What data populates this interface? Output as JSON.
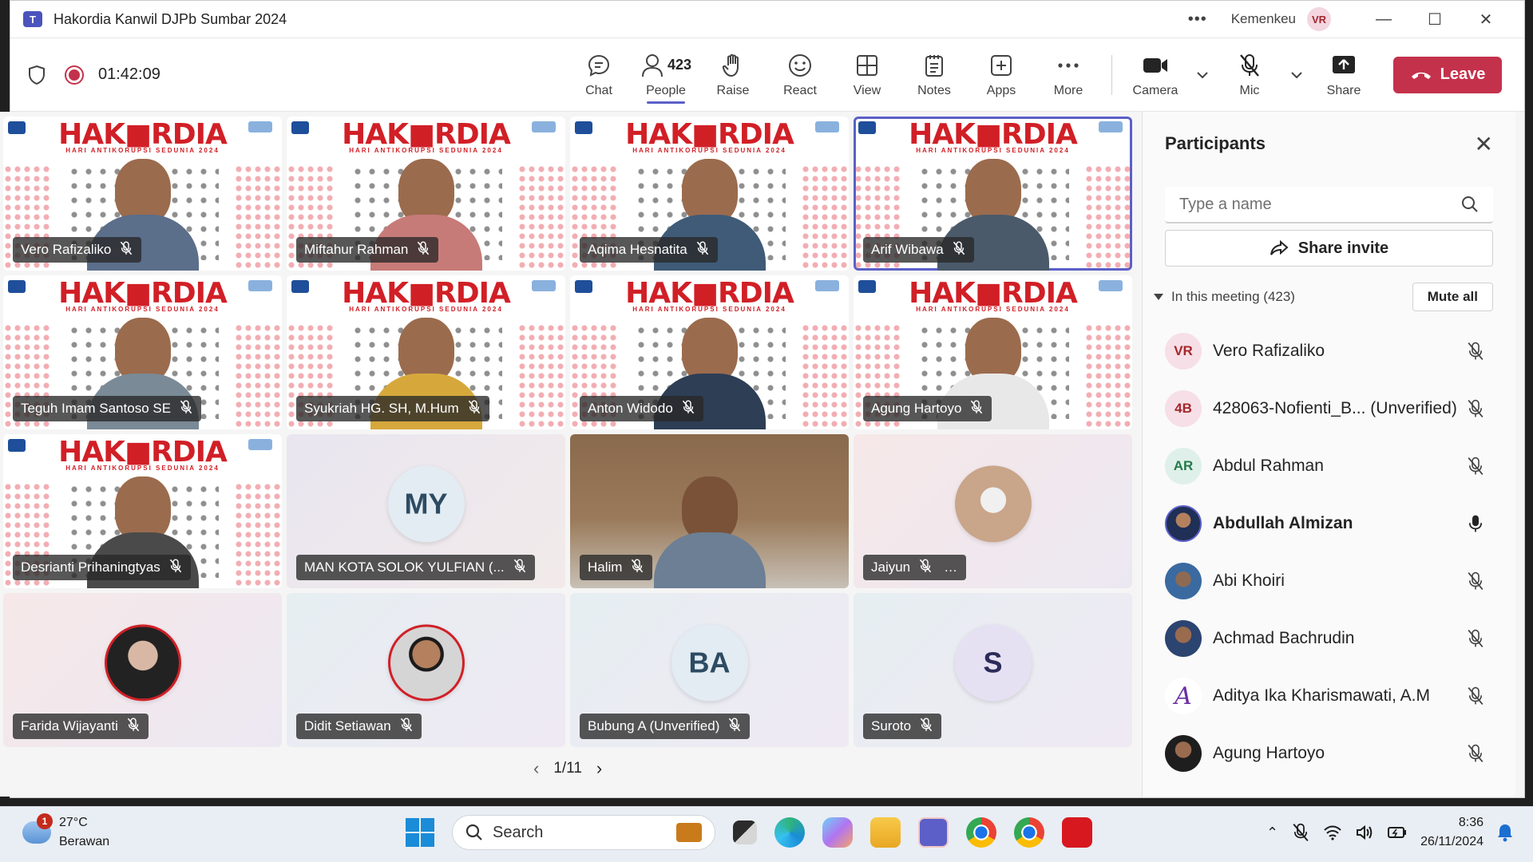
{
  "window": {
    "title": "Hakordia Kanwil DJPb Sumbar 2024",
    "org": "Kemenkeu",
    "user_initials": "VR",
    "logo_letter": "T"
  },
  "toolbar": {
    "timer": "01:42:09",
    "people_count": "423",
    "buttons": {
      "chat": "Chat",
      "people": "People",
      "raise": "Raise",
      "react": "React",
      "view": "View",
      "notes": "Notes",
      "apps": "Apps",
      "more": "More",
      "camera": "Camera",
      "mic": "Mic",
      "share": "Share"
    },
    "leave": "Leave"
  },
  "banner": {
    "title": "HAK■RDIA",
    "subtitle": "HARI ANTIKORUPSI SEDUNIA 2024"
  },
  "tiles": [
    {
      "name": "Vero Rafizaliko"
    },
    {
      "name": "Miftahur Rahman"
    },
    {
      "name": "Aqima Hesnatita"
    },
    {
      "name": "Arif Wibawa"
    },
    {
      "name": "Teguh Imam Santoso SE"
    },
    {
      "name": "Syukriah HG. SH, M.Hum"
    },
    {
      "name": "Anton Widodo"
    },
    {
      "name": "Agung Hartoyo"
    },
    {
      "name": "Desrianti Prihaningtyas"
    },
    {
      "name": "MAN KOTA SOLOK YULFIAN (...",
      "initials": "MY"
    },
    {
      "name": "Halim"
    },
    {
      "name": "Jaiyun",
      "more": "…"
    },
    {
      "name": "Farida Wijayanti"
    },
    {
      "name": "Didit Setiawan"
    },
    {
      "name": "Bubung A (Unverified)",
      "initials": "BA"
    },
    {
      "name": "Suroto",
      "initials": "S"
    }
  ],
  "pager": {
    "label": "1/11"
  },
  "participants": {
    "title": "Participants",
    "search_placeholder": "Type a name",
    "share_invite": "Share invite",
    "section_label": "In this meeting (423)",
    "mute_all": "Mute all",
    "list": [
      {
        "initials": "VR",
        "name": "Vero Rafizaliko",
        "mic": "muted"
      },
      {
        "initials": "4B",
        "name": "428063-Nofienti_B... (Unverified)",
        "mic": "muted"
      },
      {
        "initials": "AR",
        "name": "Abdul Rahman",
        "mic": "muted"
      },
      {
        "initials": "",
        "name": "Abdullah Almizan",
        "mic": "on"
      },
      {
        "initials": "",
        "name": "Abi Khoiri",
        "mic": "muted"
      },
      {
        "initials": "",
        "name": "Achmad Bachrudin",
        "mic": "muted"
      },
      {
        "initials": "A",
        "name": "Aditya Ika Kharismawati, A.M",
        "mic": "muted"
      },
      {
        "initials": "",
        "name": "Agung Hartoyo",
        "mic": "muted"
      }
    ]
  },
  "taskbar": {
    "weather_temp": "27°C",
    "weather_desc": "Berawan",
    "weather_badge": "1",
    "search": "Search",
    "time": "8:36",
    "date": "26/11/2024"
  }
}
